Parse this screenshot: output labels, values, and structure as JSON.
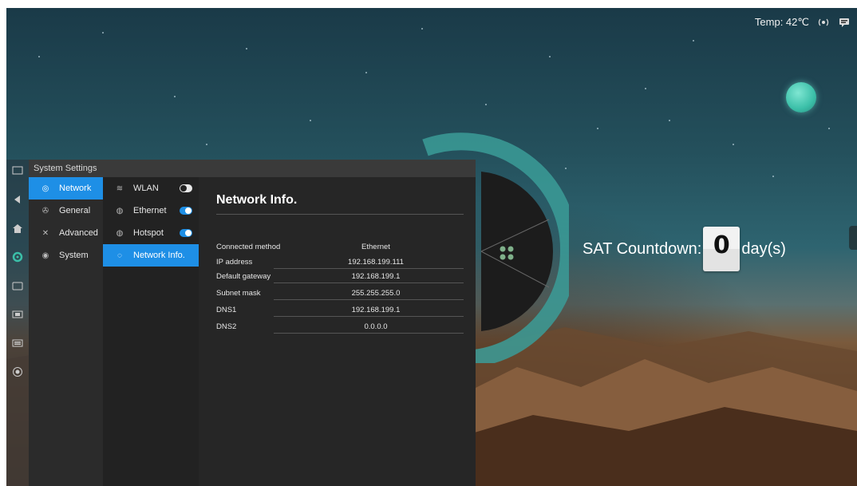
{
  "status_bar": {
    "temp": "Temp: 42℃",
    "icons": [
      "signal-icon",
      "chat-icon"
    ]
  },
  "settings": {
    "title": "System Settings",
    "menu": [
      {
        "label": "Network",
        "icon": "network-icon",
        "active": true
      },
      {
        "label": "General",
        "icon": "gear-icon",
        "active": false
      },
      {
        "label": "Advanced",
        "icon": "tools-icon",
        "active": false
      },
      {
        "label": "System",
        "icon": "system-icon",
        "active": false
      }
    ],
    "submenu": [
      {
        "label": "WLAN",
        "icon": "wifi-icon",
        "toggle": "off"
      },
      {
        "label": "Ethernet",
        "icon": "ethernet-icon",
        "toggle": "on"
      },
      {
        "label": "Hotspot",
        "icon": "hotspot-icon",
        "toggle": "on"
      },
      {
        "label": "Network Info.",
        "icon": "info-icon",
        "active": true
      }
    ],
    "network_info": {
      "title": "Network Info.",
      "rows": [
        {
          "key": "Connected method",
          "value": "Ethernet"
        },
        {
          "key": "IP address",
          "value": "192.168.199.111"
        },
        {
          "key": "Default gateway",
          "value": "192.168.199.1"
        },
        {
          "key": "Subnet mask",
          "value": "255.255.255.0"
        },
        {
          "key": "DNS1",
          "value": "192.168.199.1"
        },
        {
          "key": "DNS2",
          "value": "0.0.0.0"
        }
      ]
    }
  },
  "countdown": {
    "prefix": "SAT Countdown:",
    "digit": "0",
    "suffix": "day(s)"
  },
  "colors": {
    "accent": "#1e8fe6",
    "panel": "#262626",
    "teal": "#3bbfa8"
  }
}
